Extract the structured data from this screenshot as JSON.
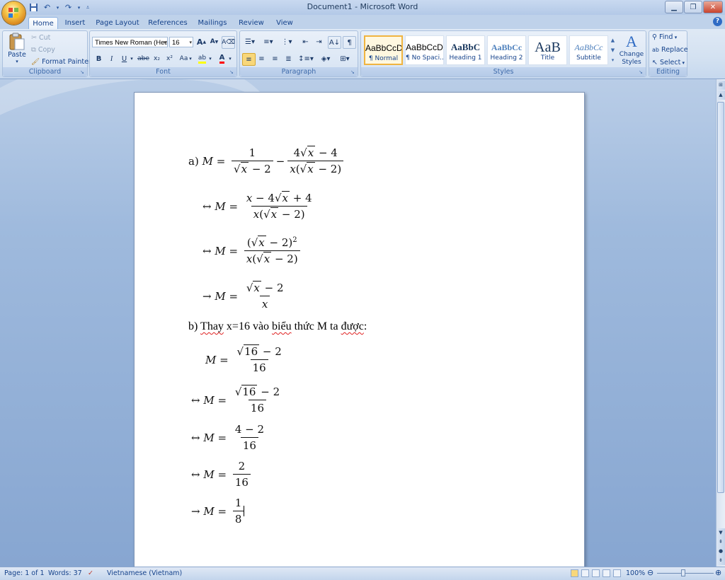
{
  "window": {
    "title": "Document1 - Microsoft Word"
  },
  "tabs": [
    "Home",
    "Insert",
    "Page Layout",
    "References",
    "Mailings",
    "Review",
    "View"
  ],
  "clipboard": {
    "paste": "Paste",
    "cut": "Cut",
    "copy": "Copy",
    "format_painter": "Format Painter",
    "label": "Clipboard"
  },
  "font": {
    "name": "Times New Roman (Hea",
    "size": "16",
    "label": "Font",
    "bold": "B",
    "italic": "I",
    "underline": "U",
    "strike": "abe",
    "sub": "x₂",
    "sup": "x²",
    "case": "Aa",
    "grow": "A",
    "shrink": "A"
  },
  "paragraph": {
    "label": "Paragraph"
  },
  "styles": {
    "label": "Styles",
    "items": [
      {
        "preview": "AaBbCcD",
        "name": "¶ Normal"
      },
      {
        "preview": "AaBbCcD",
        "name": "¶ No Spaci..."
      },
      {
        "preview": "AaBbC",
        "name": "Heading 1"
      },
      {
        "preview": "AaBbCc",
        "name": "Heading 2"
      },
      {
        "preview": "AaB",
        "name": "Title"
      },
      {
        "preview": "AaBbCc",
        "name": "Subtitle"
      }
    ],
    "change_styles": "Change Styles"
  },
  "editing": {
    "find": "Find",
    "replace": "Replace",
    "select": "Select",
    "label": "Editing"
  },
  "doc": {
    "part_b_text": "b) Thay x=16 vào biểu thức M ta được:",
    "part_b_pre": "b) ",
    "part_b_word1": "Thay",
    "part_b_mid": " x=16 vào ",
    "part_b_word2": "biểu",
    "part_b_mid2": " thức M ta ",
    "part_b_word3": "được",
    "part_b_end": ":"
  },
  "status": {
    "page": "Page: 1 of 1",
    "words": "Words: 37",
    "language": "Vietnamese (Vietnam)",
    "zoom": "100%"
  },
  "colors": {
    "accent": "#15428b",
    "highlight": "#ffff00",
    "font_color": "#ff0000"
  }
}
